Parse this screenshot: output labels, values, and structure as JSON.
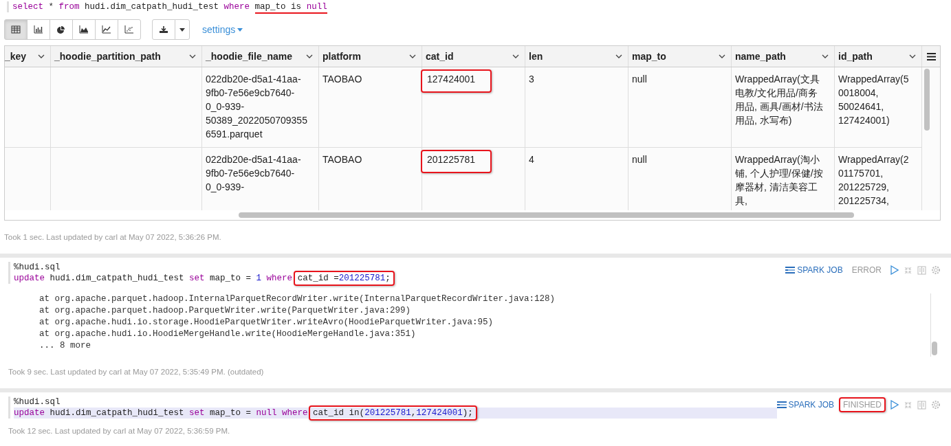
{
  "paragraphs": [
    {
      "code": [
        {
          "active": false,
          "segments": [
            {
              "kind": "plain",
              "tokens": [
                {
                  "kind": "keyword",
                  "text": "select"
                },
                {
                  "kind": "plain",
                  "text": " * "
                },
                {
                  "kind": "keyword",
                  "text": "from"
                },
                {
                  "kind": "plain",
                  "text": " hudi.dim_catpath_hudi_test "
                },
                {
                  "kind": "keyword",
                  "text": "where "
                }
              ]
            },
            {
              "kind": "underlined",
              "tokens": [
                {
                  "kind": "plain",
                  "text": "map_to is "
                },
                {
                  "kind": "keyword",
                  "text": "null"
                }
              ]
            }
          ]
        }
      ],
      "toolbar": {
        "views": [
          {
            "selected": true
          },
          {
            "selected": false
          },
          {
            "selected": false
          },
          {
            "selected": false
          },
          {
            "selected": false
          },
          {
            "selected": false
          }
        ],
        "settings": "settings"
      },
      "table": {
        "columns": [
          "_key",
          "_hoodie_partition_path",
          "_hoodie_file_name",
          "platform",
          "cat_id",
          "len",
          "map_to",
          "name_path",
          "id_path"
        ],
        "rows": [
          [
            null,
            null,
            {
              "text": "022db20e-d5a1-41aa-9fb0-7e56e9cb7640-0_0-939-50389_20220507093556591.parquet",
              "boxed": false
            },
            {
              "text": "TAOBAO",
              "boxed": false
            },
            {
              "text": "127424001",
              "boxed": true
            },
            {
              "text": "3",
              "boxed": false
            },
            {
              "text": "null",
              "boxed": false
            },
            {
              "text": "WrappedArray(文具电教/文化用品/商务用品, 画具/画材/书法用品, 水写布)",
              "boxed": false
            },
            {
              "text": "WrappedArray(50018004, 50024641, 127424001)",
              "boxed": false
            }
          ],
          [
            null,
            null,
            {
              "text": "022db20e-d5a1-41aa-9fb0-7e56e9cb7640-0_0-939-",
              "boxed": false
            },
            {
              "text": "TAOBAO",
              "boxed": false
            },
            {
              "text": "201225781",
              "boxed": true
            },
            {
              "text": "4",
              "boxed": false
            },
            {
              "text": "null",
              "boxed": false
            },
            {
              "text": "WrappedArray(淘小铺, 个人护理/保健/按摩器材, 清洁美容工具,",
              "boxed": false
            },
            {
              "text": "WrappedArray(201175701, 201225729, 201225734,",
              "boxed": false
            }
          ]
        ]
      },
      "footer": "Took 1 sec. Last updated by carl at May 07 2022, 5:36:26 PM."
    },
    {
      "header": {
        "job": "SPARK JOB",
        "status": "ERROR",
        "status_boxed": false
      },
      "code": [
        {
          "active": false,
          "segments": [
            {
              "kind": "plain",
              "tokens": [
                {
                  "kind": "plain",
                  "text": "%hudi.sql"
                }
              ]
            }
          ]
        },
        {
          "active": false,
          "segments": [
            {
              "kind": "plain",
              "tokens": [
                {
                  "kind": "keyword",
                  "text": "update"
                },
                {
                  "kind": "plain",
                  "text": " hudi.dim_catpath_hudi_test "
                },
                {
                  "kind": "keyword",
                  "text": "set"
                },
                {
                  "kind": "plain",
                  "text": " map_to = "
                },
                {
                  "kind": "number",
                  "text": "1 "
                },
                {
                  "kind": "keyword",
                  "text": "where "
                }
              ]
            },
            {
              "kind": "boxed",
              "tokens": [
                {
                  "kind": "plain",
                  "text": "cat_id ="
                },
                {
                  "kind": "number",
                  "text": "201225781"
                },
                {
                  "kind": "plain",
                  "text": ";"
                }
              ]
            }
          ]
        }
      ],
      "output": [
        "at org.apache.parquet.hadoop.InternalParquetRecordWriter.write(InternalParquetRecordWriter.java:128)",
        "at org.apache.parquet.hadoop.ParquetWriter.write(ParquetWriter.java:299)",
        "at org.apache.hudi.io.storage.HoodieParquetWriter.writeAvro(HoodieParquetWriter.java:95)",
        "at org.apache.hudi.io.HoodieMergeHandle.write(HoodieMergeHandle.java:351)",
        "... 8 more"
      ],
      "footer": "Took 9 sec. Last updated by carl at May 07 2022, 5:35:49 PM. (outdated)"
    },
    {
      "header": {
        "job": "SPARK JOB",
        "status": "FINISHED",
        "status_boxed": true
      },
      "code": [
        {
          "active": false,
          "segments": [
            {
              "kind": "plain",
              "tokens": [
                {
                  "kind": "plain",
                  "text": "%hudi.sql"
                }
              ]
            }
          ]
        },
        {
          "active": true,
          "segments": [
            {
              "kind": "plain",
              "tokens": [
                {
                  "kind": "keyword",
                  "text": "update"
                },
                {
                  "kind": "plain",
                  "text": " hudi.dim_catpath_hudi_test "
                },
                {
                  "kind": "keyword",
                  "text": "set"
                },
                {
                  "kind": "plain",
                  "text": " map_to = "
                },
                {
                  "kind": "keyword",
                  "text": "null where "
                }
              ]
            },
            {
              "kind": "boxed",
              "tokens": [
                {
                  "kind": "plain",
                  "text": "cat_id in("
                },
                {
                  "kind": "number",
                  "text": "201225781"
                },
                {
                  "kind": "plain",
                  "text": ","
                },
                {
                  "kind": "number",
                  "text": "127424001"
                },
                {
                  "kind": "plain",
                  "text": ");"
                }
              ]
            }
          ]
        }
      ],
      "footer": "Took 12 sec. Last updated by carl at May 07 2022, 5:36:59 PM."
    }
  ]
}
